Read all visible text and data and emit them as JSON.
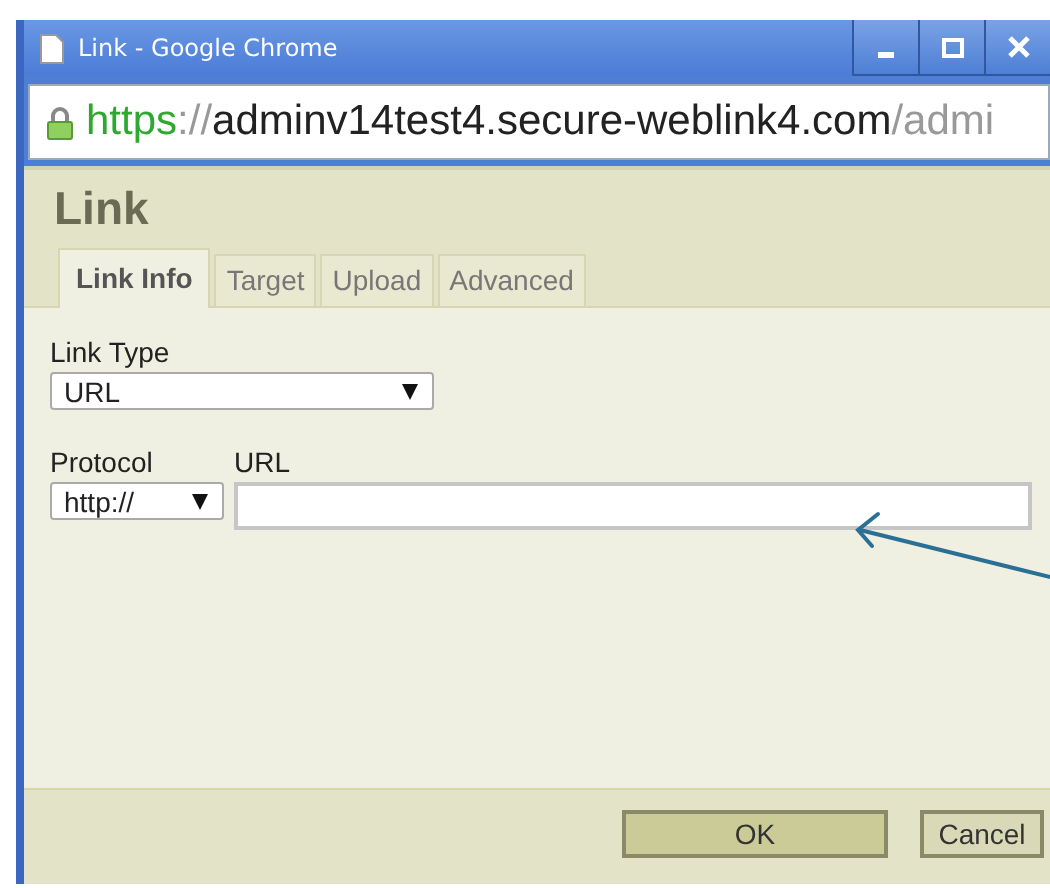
{
  "window": {
    "title": "Link - Google Chrome",
    "controls": [
      {
        "kind": "minimize"
      },
      {
        "kind": "maximize"
      },
      {
        "kind": "close"
      }
    ]
  },
  "address": {
    "scheme": "https",
    "separator": "://",
    "host": "adminv14test4.secure-weblink4.com",
    "path": "/admi",
    "secure": true
  },
  "dialog": {
    "title": "Link",
    "tabs": [
      {
        "label": "Link Info",
        "selected": true
      },
      {
        "label": "Target",
        "selected": false
      },
      {
        "label": "Upload",
        "selected": false
      },
      {
        "label": "Advanced",
        "selected": false
      }
    ],
    "link_type": {
      "label": "Link Type",
      "value": "URL"
    },
    "protocol": {
      "label": "Protocol",
      "value": "http://"
    },
    "url": {
      "label": "URL"
    },
    "buttons": [
      {
        "label": "OK",
        "kind": "ok"
      },
      {
        "label": "Cancel",
        "kind": "cancel"
      }
    ]
  }
}
